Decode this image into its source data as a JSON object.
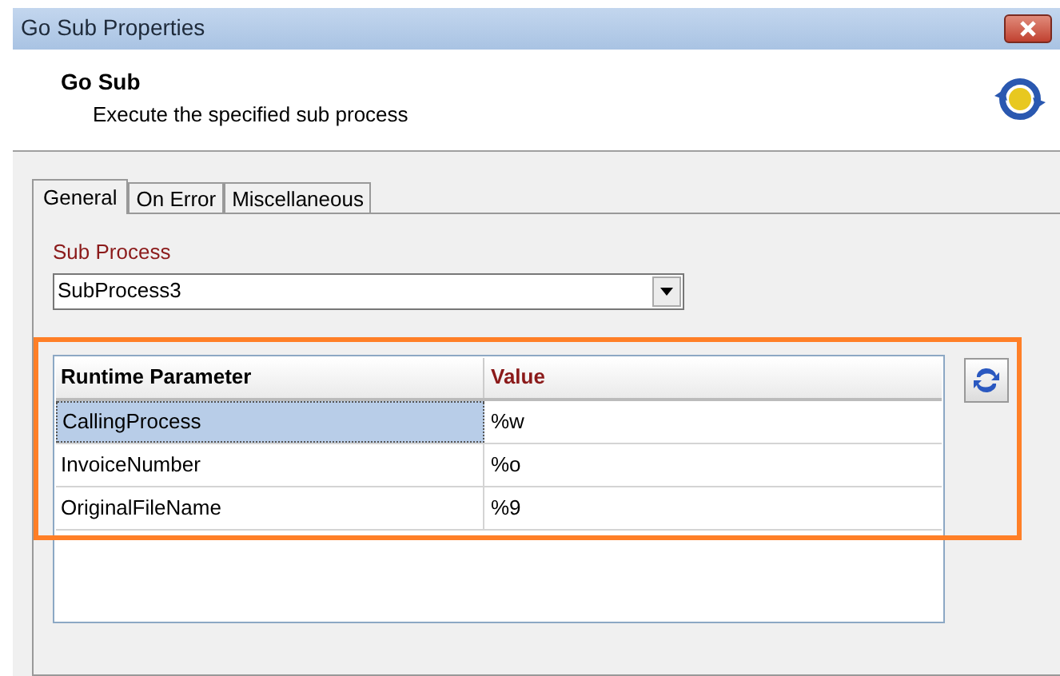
{
  "window": {
    "title": "Go Sub Properties"
  },
  "header": {
    "title": "Go Sub",
    "description": "Execute the specified sub process"
  },
  "tabs": [
    {
      "label": "General",
      "selected": true
    },
    {
      "label": "On Error",
      "selected": false
    },
    {
      "label": "Miscellaneous",
      "selected": false
    }
  ],
  "sub_process": {
    "label": "Sub Process",
    "value": "SubProcess3"
  },
  "table": {
    "columns": [
      "Runtime Parameter",
      "Value"
    ],
    "rows": [
      {
        "cells": [
          "CallingProcess",
          "%w"
        ],
        "selected": true
      },
      {
        "cells": [
          "InvoiceNumber",
          "%o"
        ],
        "selected": false
      },
      {
        "cells": [
          "OriginalFileName",
          "%9"
        ],
        "selected": false
      }
    ]
  }
}
